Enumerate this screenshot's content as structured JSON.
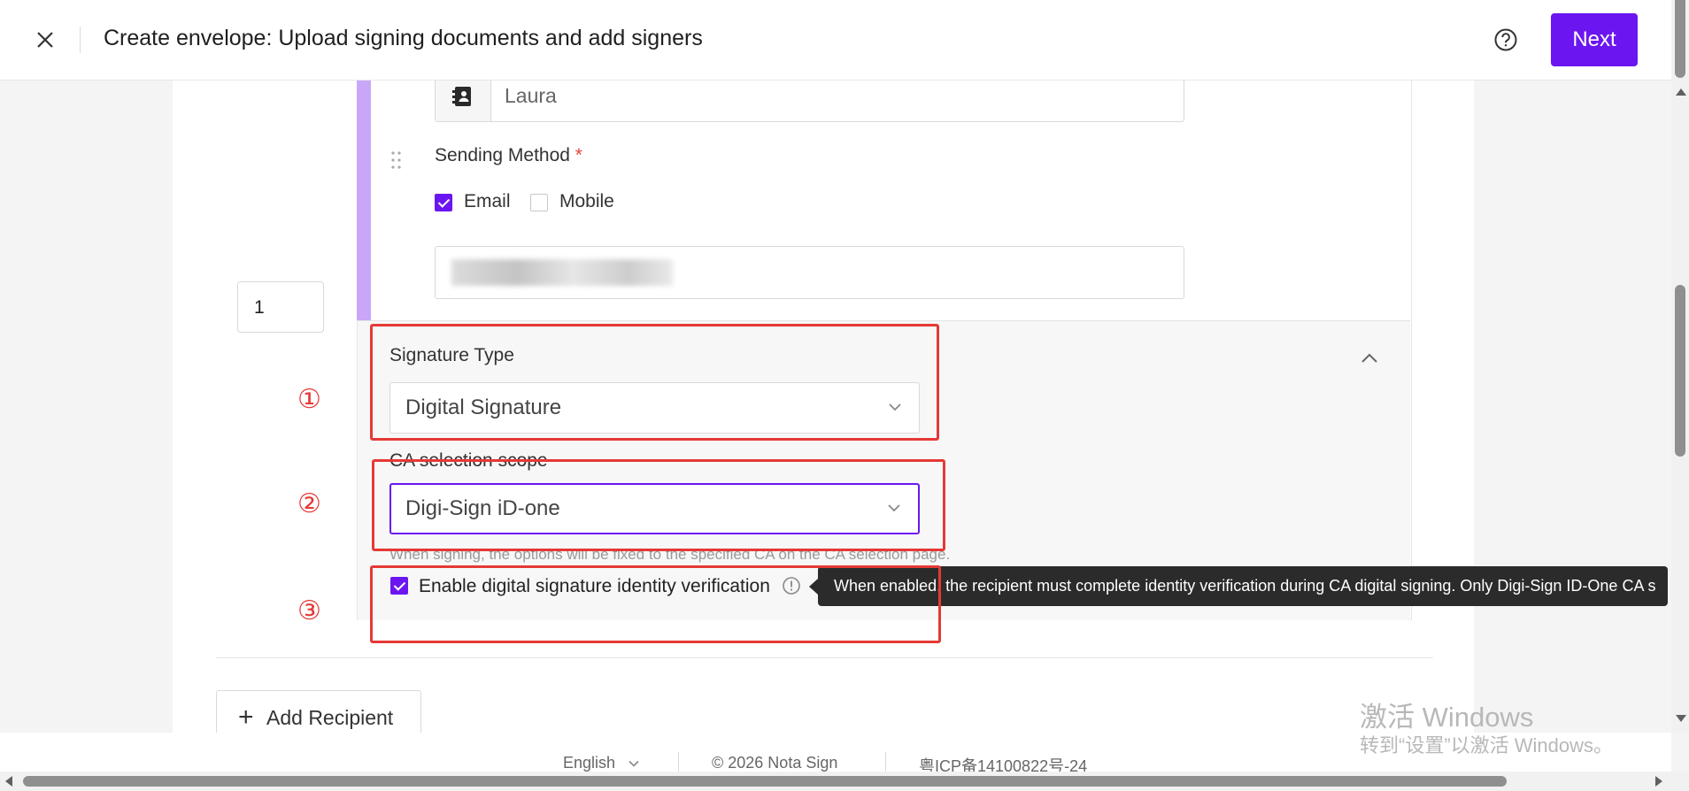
{
  "header": {
    "title": "Create envelope: Upload signing documents and add signers",
    "next_label": "Next",
    "close_icon": "close-icon",
    "help_icon": "help-circle-icon"
  },
  "recipient": {
    "order": "1",
    "name": "Laura",
    "name_icon": "contact-book-icon",
    "sending_method_label": "Sending Method",
    "required_mark": "*",
    "methods": [
      {
        "label": "Email",
        "checked": true
      },
      {
        "label": "Mobile",
        "checked": false
      }
    ]
  },
  "signature": {
    "type_label": "Signature Type",
    "type_value": "Digital Signature",
    "ca_label": "CA selection scope",
    "ca_value": "Digi-Sign iD-one",
    "ca_hint": "When signing, the options will be fixed to the specified CA on the CA selection page.",
    "verify_label": "Enable digital signature identity verification",
    "verify_checked": true,
    "tooltip": "When enabled, the recipient must complete identity verification during CA digital signing. Only Digi-Sign ID-One CA s"
  },
  "annotations": [
    "①",
    "②",
    "③"
  ],
  "add_recipient_label": "Add Recipient",
  "footer": {
    "language": "English",
    "copyright": "© 2026 Nota Sign",
    "icp": "粤ICP备14100822号-24"
  },
  "watermark": {
    "line1": "激活 Windows",
    "line2": "转到“设置”以激活 Windows。"
  },
  "colors": {
    "accent": "#6b16f0",
    "annotation": "#e53935",
    "side_bar": "#c9a6f7"
  }
}
